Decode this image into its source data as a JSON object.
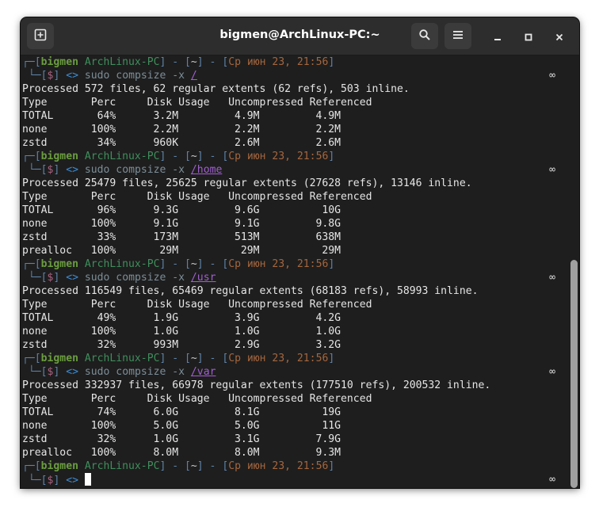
{
  "window": {
    "title": "bigmen@ArchLinux-PC:~"
  },
  "icons": {
    "new_tab": "new-tab-icon",
    "search": "search-icon",
    "menu": "hamburger-menu-icon",
    "minimize": "minimize-icon",
    "maximize": "maximize-icon",
    "close": "close-icon"
  },
  "colors": {
    "background": "#1e1e1e",
    "titlebar": "#2d2d2d",
    "user": "#6b9d3f",
    "host": "#3f8e5c",
    "date": "#a5663e",
    "dollar": "#a8607e",
    "arrows": "#3e8bd0",
    "argument": "#a05fd0"
  },
  "prompt": {
    "bracket_open": "┌─[",
    "user": "bigmen",
    "host": "ArchLinux-PC",
    "sep": "] - [",
    "path": "~",
    "date": "Ср июн 23, 21:56",
    "bracket_close": "]",
    "line2_prefix": "└─[",
    "dollar": "$",
    "line2_close": "]",
    "arrows": "<>",
    "command": "sudo compsize -x",
    "infinity": "∞"
  },
  "sessions": [
    {
      "arg": "/",
      "processed": "Processed 572 files, 62 regular extents (62 refs), 503 inline.",
      "header": "Type       Perc     Disk Usage   Uncompressed Referenced",
      "rows": [
        "TOTAL       64%      3.2M         4.9M         4.9M",
        "none       100%      2.2M         2.2M         2.2M",
        "zstd        34%      960K         2.6M         2.6M"
      ]
    },
    {
      "arg": "/home",
      "processed": "Processed 25479 files, 25625 regular extents (27628 refs), 13146 inline.",
      "header": "Type       Perc     Disk Usage   Uncompressed Referenced",
      "rows": [
        "TOTAL       96%      9.3G         9.6G          10G",
        "none       100%      9.1G         9.1G         9.8G",
        "zstd        33%      173M         513M         638M",
        "prealloc   100%       29M          29M          29M"
      ]
    },
    {
      "arg": "/usr",
      "processed": "Processed 116549 files, 65469 regular extents (68183 refs), 58993 inline.",
      "header": "Type       Perc     Disk Usage   Uncompressed Referenced",
      "rows": [
        "TOTAL       49%      1.9G         3.9G         4.2G",
        "none       100%      1.0G         1.0G         1.0G",
        "zstd        32%      993M         2.9G         3.2G"
      ]
    },
    {
      "arg": "/var",
      "processed": "Processed 332937 files, 66978 regular extents (177510 refs), 200532 inline.",
      "header": "Type       Perc     Disk Usage   Uncompressed Referenced",
      "rows": [
        "TOTAL       74%      6.0G         8.1G          19G",
        "none       100%      5.0G         5.0G          11G",
        "zstd        32%      1.0G         3.1G         7.9G",
        "prealloc   100%      8.0M         8.0M         9.3M"
      ]
    }
  ]
}
